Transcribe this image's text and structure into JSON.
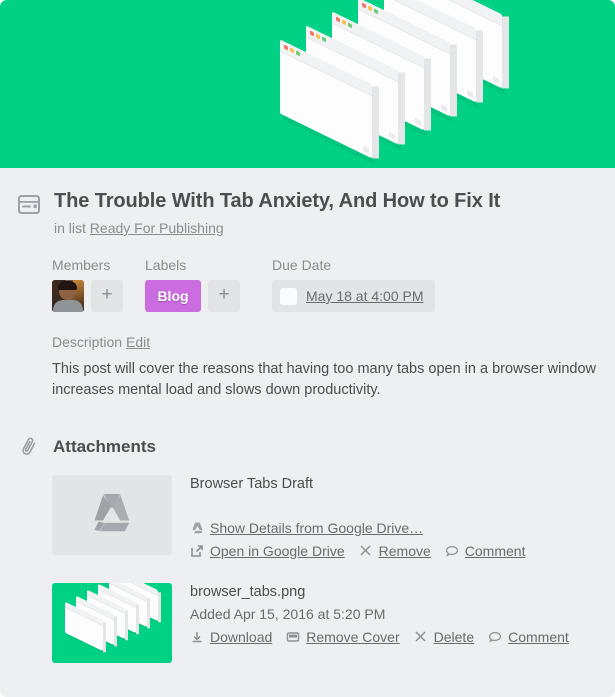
{
  "cover": {
    "background_color": "#00d184",
    "art_name": "stacked-browser-windows-illustration"
  },
  "card": {
    "icon": "card-window-icon",
    "title": "The Trouble With Tab Anxiety, And How to Fix It",
    "in_list_prefix": "in list",
    "list_name": "Ready For Publishing"
  },
  "meta": {
    "members": {
      "label": "Members",
      "add_label": "+",
      "avatar_name": "member-avatar"
    },
    "labels": {
      "label": "Labels",
      "add_label": "+",
      "chips": [
        {
          "text": "Blog",
          "color": "#cb6ce0"
        }
      ]
    },
    "due_date": {
      "label": "Due Date",
      "value": "May 18 at 4:00 PM",
      "checked": false
    }
  },
  "description": {
    "heading": "Description",
    "edit_label": "Edit",
    "text": "This post will cover the reasons that having too many tabs open in a browser window increases mental load and slows down productivity."
  },
  "attachments": {
    "icon": "paperclip-icon",
    "heading": "Attachments",
    "items": [
      {
        "thumb_kind": "drive",
        "thumb_icon": "google-drive-icon",
        "name": "Browser Tabs Draft",
        "subtitle": "",
        "actions": [
          {
            "icon": "google-drive-icon",
            "label": "Show Details from Google Drive…"
          },
          {
            "icon": "external-link-icon",
            "label": "Open in Google Drive"
          },
          {
            "icon": "close-x-icon",
            "label": "Remove"
          },
          {
            "icon": "speech-bubble-icon",
            "label": "Comment"
          }
        ]
      },
      {
        "thumb_kind": "png",
        "thumb_icon": "browser-tabs-thumbnail",
        "name": "browser_tabs.png",
        "subtitle": "Added Apr 15, 2016 at 5:20 PM",
        "actions": [
          {
            "icon": "download-icon",
            "label": "Download"
          },
          {
            "icon": "cover-rect-icon",
            "label": "Remove Cover"
          },
          {
            "icon": "close-x-icon",
            "label": "Delete"
          },
          {
            "icon": "speech-bubble-icon",
            "label": "Comment"
          }
        ]
      }
    ]
  },
  "colors": {
    "page_bg": "#edeff1",
    "accent_green": "#00d184",
    "label_purple": "#cb6ce0",
    "text_dark": "#4d4d4d",
    "text_muted": "#8c8c8c"
  }
}
